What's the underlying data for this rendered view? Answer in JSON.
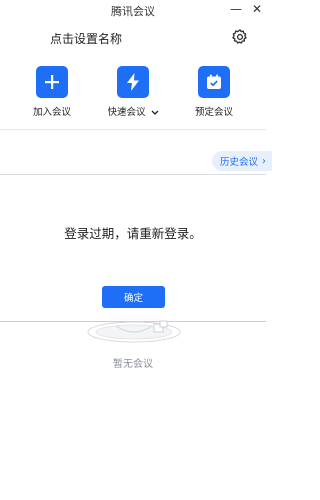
{
  "window": {
    "title": "腾讯会议",
    "minimize_glyph": "—",
    "close_glyph": "✕"
  },
  "header": {
    "name_prompt": "点击设置名称",
    "settings_icon": "gear-icon"
  },
  "actions": [
    {
      "label": "加入会议",
      "icon": "plus-icon"
    },
    {
      "label": "快速会议",
      "icon": "lightning-icon",
      "has_dropdown": true
    },
    {
      "label": "预定会议",
      "icon": "calendar-check-icon"
    }
  ],
  "history": {
    "label": "历史会议",
    "chevron": "›"
  },
  "dialog": {
    "message": "登录过期，请重新登录。",
    "confirm_label": "确定"
  },
  "empty_state": {
    "text": "暂无会议",
    "icon": "empty-box-icon"
  },
  "colors": {
    "accent": "#1e6ff5",
    "history_bg": "#e7effd",
    "muted_text": "#8a8f99"
  }
}
